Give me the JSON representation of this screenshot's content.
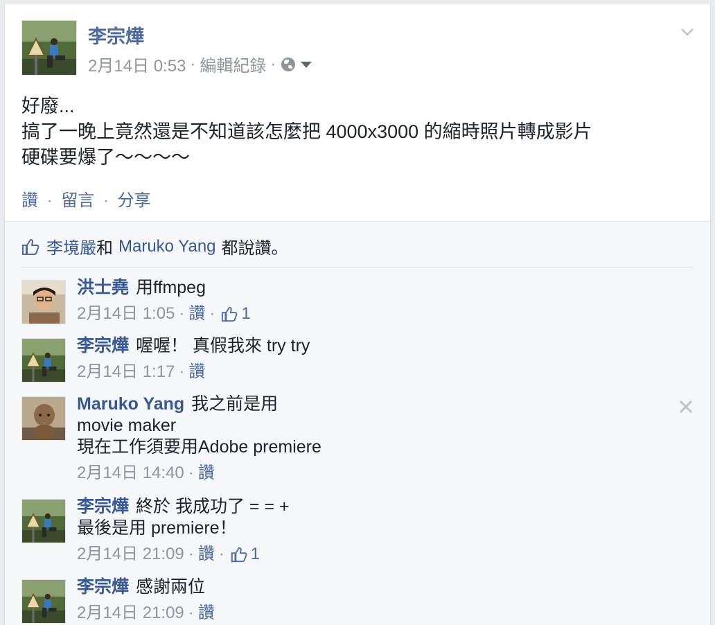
{
  "post": {
    "author": "李宗燁",
    "date": "2月14日 0:53",
    "edit_history": "編輯紀錄",
    "meta_sep": "·",
    "privacy_icon": "globe-icon",
    "body_lines": [
      "好廢...",
      "搞了一晚上竟然還是不知道該怎麼把 4000x3000 的縮時照片轉成影片",
      "硬碟要爆了～～～～"
    ],
    "actions": {
      "like": "讚",
      "comment": "留言",
      "share": "分享",
      "sep": "·"
    }
  },
  "likes_summary": {
    "name1": "李境嚴",
    "conj": "和",
    "name2": "Maruko Yang",
    "suffix": "都說讚。"
  },
  "comments": [
    {
      "author": "洪士堯",
      "lines": [
        "用ffmpeg"
      ],
      "date": "2月14日 1:05",
      "like_label": "讚",
      "likes": "1"
    },
    {
      "author": "李宗燁",
      "lines": [
        "喔喔！ 真假我來 try try"
      ],
      "date": "2月14日 1:17",
      "like_label": "讚"
    },
    {
      "author": "Maruko Yang",
      "lines": [
        "我之前是用",
        "movie maker",
        "現在工作須要用Adobe premiere"
      ],
      "date": "2月14日 14:40",
      "like_label": "讚"
    },
    {
      "author": "李宗燁",
      "lines": [
        "終於 我成功了 = = +",
        "最後是用 premiere！"
      ],
      "date": "2月14日 21:09",
      "like_label": "讚",
      "likes": "1"
    },
    {
      "author": "李宗燁",
      "lines": [
        "感謝兩位"
      ],
      "date": "2月14日 21:09",
      "like_label": "讚"
    }
  ],
  "colors": {
    "link": "#365899",
    "meta": "#90949c",
    "text": "#1d2129",
    "feedback_bg": "#f6f7f9"
  }
}
